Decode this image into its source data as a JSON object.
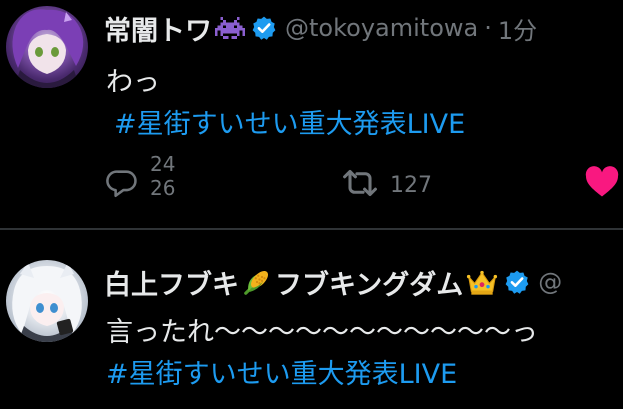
{
  "tweets": [
    {
      "display_name": "常闇トワ",
      "name_emoji": "space-invader",
      "verified": true,
      "handle": "@tokoyamitowa",
      "separator": "·",
      "time": "1分",
      "text": "わっ",
      "hashtag": "#星街すいせい重大発表LIVE",
      "reply_count": "24",
      "reply_count_next": "26",
      "retweet_count": "127",
      "liked": true
    },
    {
      "display_name_part1": "白上フブキ",
      "name_emoji_1": "corn",
      "display_name_part2": "フブキングダム",
      "name_emoji_2": "crown",
      "verified": true,
      "handle_partial": "@",
      "text": "言ったれ〜〜〜〜〜〜〜〜〜〜〜っ",
      "hashtag": "#星街すいせい重大発表LIVE"
    }
  ],
  "colors": {
    "background": "#000000",
    "text": "#e7e9ea",
    "secondary": "#71767b",
    "link": "#1d9bf0",
    "verified": "#1d9bf0",
    "like": "#f91880",
    "divider": "#2f3336"
  },
  "icons": {
    "reply": "reply-icon",
    "retweet": "retweet-icon",
    "like": "heart-icon",
    "verified": "verified-badge-icon"
  }
}
